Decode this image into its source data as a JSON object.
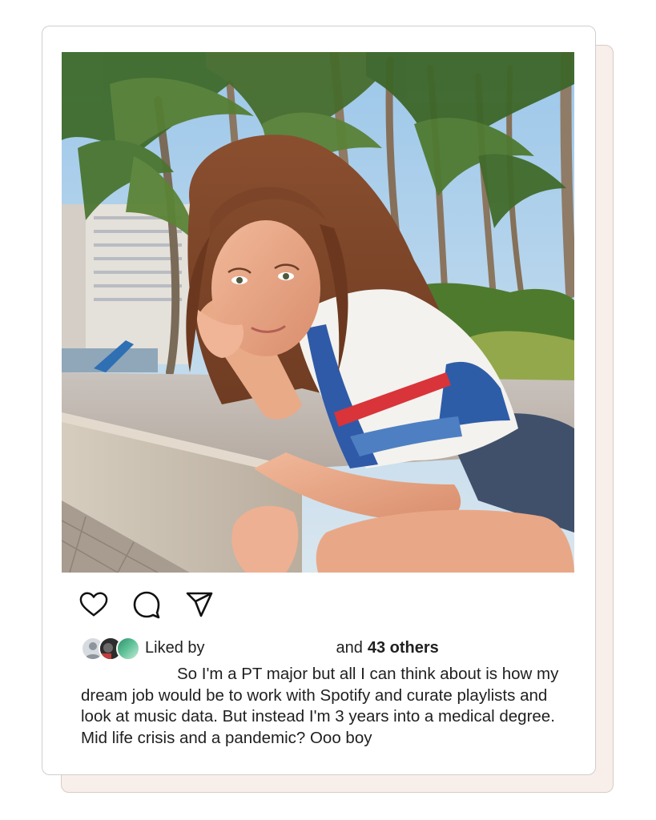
{
  "post": {
    "actions": [
      {
        "name": "like-icon"
      },
      {
        "name": "comment-icon"
      },
      {
        "name": "share-icon"
      }
    ],
    "likes": {
      "liked_by_label": "Liked by",
      "and_label": "and",
      "others_count": "43 others"
    },
    "caption": "So I'm a PT major but all I can think about is how my dream job would be to work with Spotify and curate playlists and look at music data. But instead I'm 3 years into a medical degree. Mid life crisis and a pandemic? Ooo boy"
  },
  "colors": {
    "card_shadow": "#f8efea",
    "text": "#1f1f1f"
  }
}
